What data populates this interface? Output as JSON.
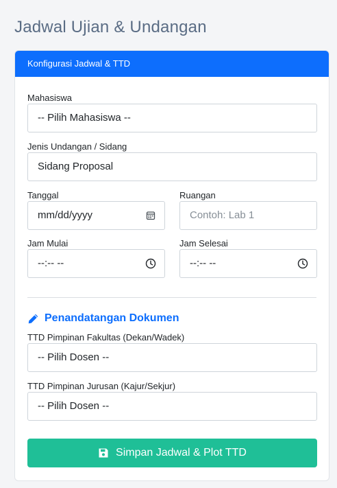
{
  "page": {
    "title": "Jadwal Ujian & Undangan"
  },
  "card": {
    "header": "Konfigurasi Jadwal & TTD"
  },
  "form": {
    "mahasiswa": {
      "label": "Mahasiswa",
      "value": "-- Pilih Mahasiswa --"
    },
    "jenis": {
      "label": "Jenis Undangan / Sidang",
      "value": "Sidang Proposal"
    },
    "tanggal": {
      "label": "Tanggal",
      "placeholder": "mm/dd/yyyy"
    },
    "ruangan": {
      "label": "Ruangan",
      "placeholder": "Contoh: Lab 1"
    },
    "jam_mulai": {
      "label": "Jam Mulai",
      "placeholder": "--:-- --"
    },
    "jam_selesai": {
      "label": "Jam Selesai",
      "placeholder": "--:-- --"
    }
  },
  "signatures": {
    "title": "Penandatangan Dokumen",
    "fakultas": {
      "label": "TTD Pimpinan Fakultas (Dekan/Wadek)",
      "value": "-- Pilih Dosen --"
    },
    "jurusan": {
      "label": "TTD Pimpinan Jurusan (Kajur/Sekjur)",
      "value": "-- Pilih Dosen --"
    }
  },
  "submit": {
    "label": "Simpan Jadwal & Plot TTD"
  },
  "colors": {
    "primary": "#0d6efd",
    "success": "#1fbf97",
    "title": "#5a6c84"
  },
  "icons": [
    "calendar-icon",
    "clock-icon",
    "pencil-icon",
    "save-icon"
  ]
}
